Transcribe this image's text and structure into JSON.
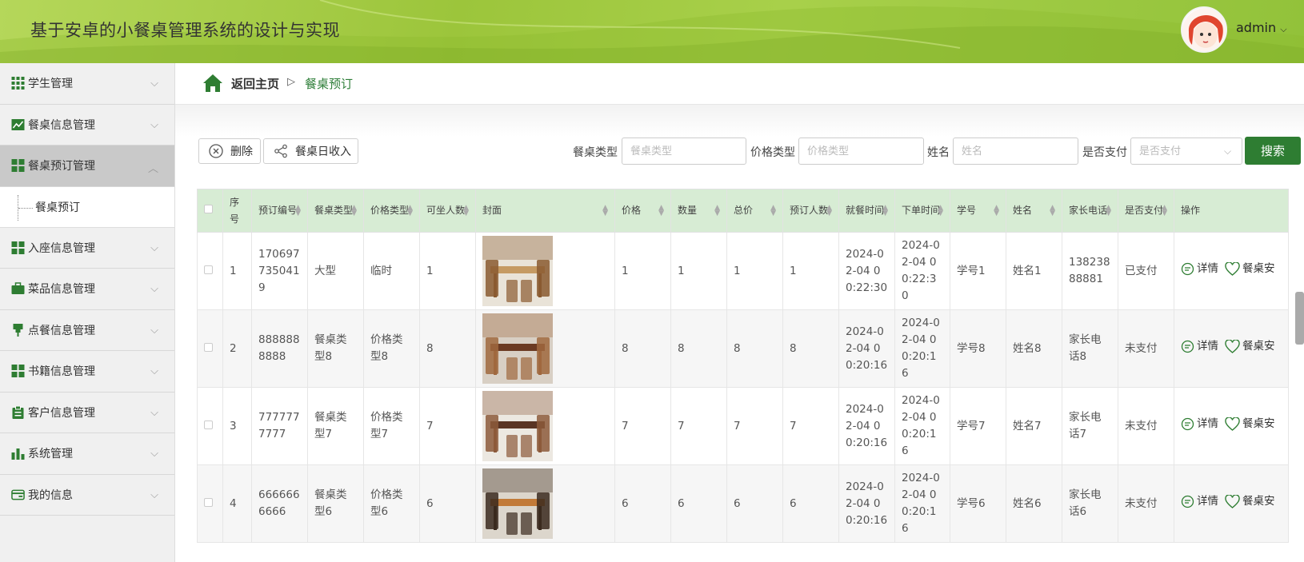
{
  "header": {
    "title": "基于安卓的小餐桌管理系统的设计与实现",
    "user": "admin"
  },
  "sidebar": {
    "items": [
      {
        "label": "学生管理",
        "icon": "grid-icon"
      },
      {
        "label": "餐桌信息管理",
        "icon": "trend-chart-icon"
      },
      {
        "label": "餐桌预订管理",
        "icon": "grid-icon",
        "active": true
      },
      {
        "label": "入座信息管理",
        "icon": "grid-icon"
      },
      {
        "label": "菜品信息管理",
        "icon": "briefcase-icon"
      },
      {
        "label": "点餐信息管理",
        "icon": "pin-icon"
      },
      {
        "label": "书籍信息管理",
        "icon": "grid-icon"
      },
      {
        "label": "客户信息管理",
        "icon": "clipboard-icon"
      },
      {
        "label": "系统管理",
        "icon": "bar-chart-icon"
      },
      {
        "label": "我的信息",
        "icon": "card-icon"
      }
    ],
    "submenu": "餐桌预订"
  },
  "breadcrumb": {
    "home": "返回主页",
    "current": "餐桌预订"
  },
  "toolbar": {
    "delete": "删除",
    "income": "餐桌日收入",
    "search": "搜索"
  },
  "filters": [
    {
      "label": "餐桌类型",
      "placeholder": "餐桌类型"
    },
    {
      "label": "价格类型",
      "placeholder": "价格类型"
    },
    {
      "label": "姓名",
      "placeholder": "姓名"
    },
    {
      "label": "是否支付",
      "placeholder": "是否支付"
    }
  ],
  "table": {
    "headers": [
      "序号",
      "预订编号",
      "餐桌类型",
      "价格类型",
      "可坐人数",
      "封面",
      "价格",
      "数量",
      "总价",
      "预订人数",
      "就餐时间",
      "下单时间",
      "学号",
      "姓名",
      "家长电话",
      "是否支付",
      "操作"
    ],
    "actions": {
      "detail": "详情",
      "arrange": "餐桌安"
    },
    "rows": [
      {
        "idx": "1",
        "code": "1706977350419",
        "type": "大型",
        "price_type": "临时",
        "seats": "1",
        "price": "1",
        "qty": "1",
        "total": "1",
        "people": "1",
        "dine_time": "2024-02-04 00:22:30",
        "order_time": "2024-02-04 00:22:30",
        "sid": "学号1",
        "name": "姓名1",
        "phone": "13823888881",
        "paid": "已支付"
      },
      {
        "idx": "2",
        "code": "8888888888",
        "type": "餐桌类型8",
        "price_type": "价格类型8",
        "seats": "8",
        "price": "8",
        "qty": "8",
        "total": "8",
        "people": "8",
        "dine_time": "2024-02-04 00:20:16",
        "order_time": "2024-02-04 00:20:16",
        "sid": "学号8",
        "name": "姓名8",
        "phone": "家长电话8",
        "paid": "未支付"
      },
      {
        "idx": "3",
        "code": "7777777777",
        "type": "餐桌类型7",
        "price_type": "价格类型7",
        "seats": "7",
        "price": "7",
        "qty": "7",
        "total": "7",
        "people": "7",
        "dine_time": "2024-02-04 00:20:16",
        "order_time": "2024-02-04 00:20:16",
        "sid": "学号7",
        "name": "姓名7",
        "phone": "家长电话7",
        "paid": "未支付"
      },
      {
        "idx": "4",
        "code": "6666666666",
        "type": "餐桌类型6",
        "price_type": "价格类型6",
        "seats": "6",
        "price": "6",
        "qty": "6",
        "total": "6",
        "people": "6",
        "dine_time": "2024-02-04 00:20:16",
        "order_time": "2024-02-04 00:20:16",
        "sid": "学号6",
        "name": "姓名6",
        "phone": "家长电话6",
        "paid": "未支付"
      }
    ]
  },
  "colors": {
    "accent": "#2e7d32",
    "header": "#9cc53b",
    "table_header": "#d7ecd4"
  }
}
